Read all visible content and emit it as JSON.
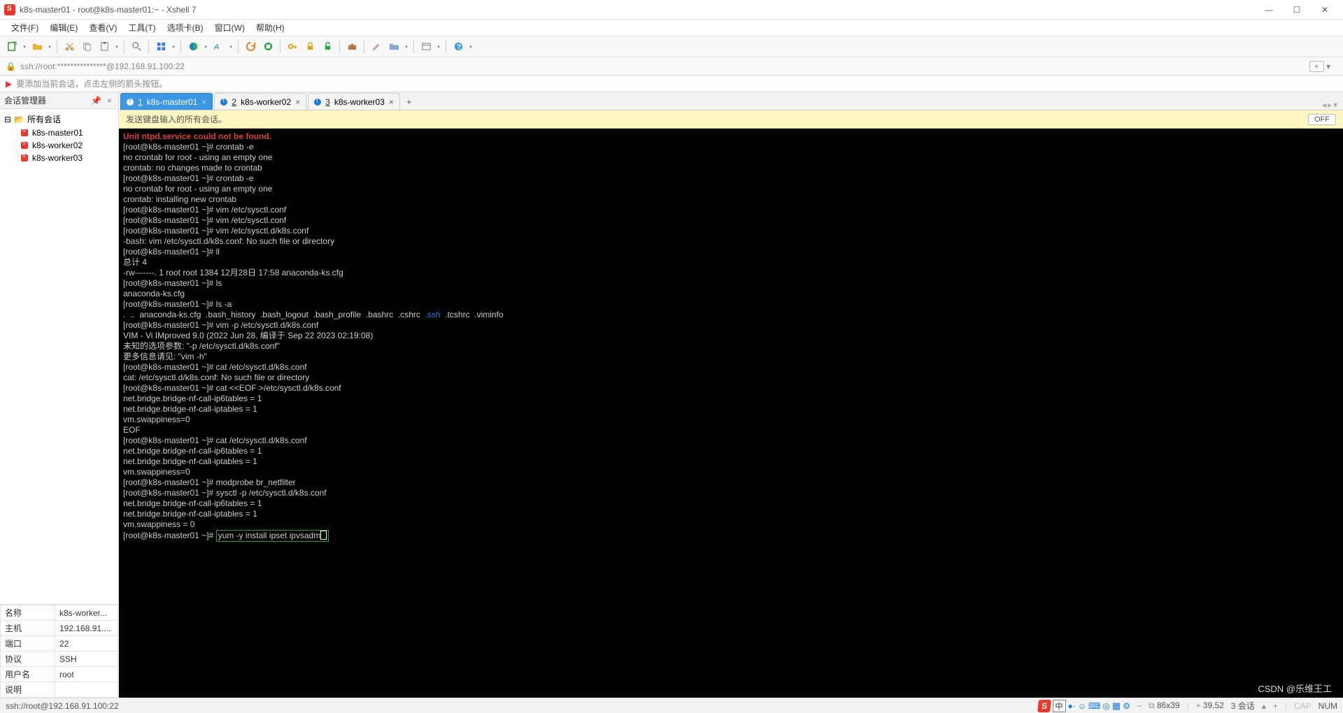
{
  "window": {
    "title": "k8s-master01 - root@k8s-master01:~ - Xshell 7",
    "minimize": "—",
    "maximize": "☐",
    "close": "✕"
  },
  "menu": {
    "file": "文件(F)",
    "edit": "编辑(E)",
    "view": "查看(V)",
    "tool": "工具(T)",
    "tabs": "选项卡(B)",
    "window": "窗口(W)",
    "help": "帮助(H)"
  },
  "url": {
    "text": "ssh://root:***************@192.168.91.100:22",
    "plus": "+"
  },
  "hint": {
    "text": "要添加当前会话，点击左侧的箭头按钮。"
  },
  "sidebar": {
    "title": "会话管理器",
    "pin": "📌",
    "close": "×",
    "root": "所有会话",
    "items": [
      "k8s-master01",
      "k8s-worker02",
      "k8s-worker03"
    ]
  },
  "props": {
    "rows": [
      {
        "k": "名称",
        "v": "k8s-worker..."
      },
      {
        "k": "主机",
        "v": "192.168.91...."
      },
      {
        "k": "端口",
        "v": "22"
      },
      {
        "k": "协议",
        "v": "SSH"
      },
      {
        "k": "用户名",
        "v": "root"
      },
      {
        "k": "说明",
        "v": ""
      }
    ]
  },
  "tabs": {
    "list": [
      {
        "num": "1",
        "label": "k8s-master01",
        "active": true
      },
      {
        "num": "2",
        "label": "k8s-worker02",
        "active": false
      },
      {
        "num": "3",
        "label": "k8s-worker03",
        "active": false
      }
    ],
    "add": "+"
  },
  "broadcast": {
    "text": "发送键盘输入的所有会话。",
    "off": "OFF"
  },
  "terminal": {
    "err": "Unit ntpd.service could not be found.",
    "l01": "[root@k8s-master01 ~]# crontab -e",
    "l02": "no crontab for root - using an empty one",
    "l03": "crontab: no changes made to crontab",
    "l04": "[root@k8s-master01 ~]# crontab -e",
    "l05": "no crontab for root - using an empty one",
    "l06": "crontab: installing new crontab",
    "l07": "[root@k8s-master01 ~]# vim /etc/sysctl.conf",
    "l08": "[root@k8s-master01 ~]# vim /etc/sysctl.conf",
    "l09": "[root@k8s-master01 ~]# vim /etc/sysctl.d/k8s.conf",
    "l10": "-bash: vim /etc/sysctl.d/k8s.conf: No such file or directory",
    "l11": "[root@k8s-master01 ~]# ll",
    "l12": "总计 4",
    "l13": "-rw-------. 1 root root 1384 12月28日 17:58 anaconda-ks.cfg",
    "l14": "[root@k8s-master01 ~]# ls",
    "l15": "anaconda-ks.cfg",
    "l16": "[root@k8s-master01 ~]# ls -a",
    "l17a": ".  ..  anaconda-ks.cfg  .bash_history  .bash_logout  .bash_profile  .bashrc  .cshrc  ",
    "l17b": ".ssh",
    "l17c": "  .tcshrc  .viminfo",
    "l18": "[root@k8s-master01 ~]# vim -p /etc/sysctl.d/k8s.conf",
    "l19": "VIM - Vi IMproved 9.0 (2022 Jun 28, 编译于 Sep 22 2023 02:19:08)",
    "l20": "未知的选项参数: \"-p /etc/sysctl.d/k8s.conf\"",
    "l21": "更多信息请见: \"vim -h\"",
    "l22": "[root@k8s-master01 ~]# cat /etc/sysctl.d/k8s.conf",
    "l23": "cat: /etc/sysctl.d/k8s.conf: No such file or directory",
    "l24": "[root@k8s-master01 ~]# cat <<EOF >/etc/sysctl.d/k8s.conf",
    "l25": "net.bridge.bridge-nf-call-ip6tables = 1",
    "l26": "net.bridge.bridge-nf-call-iptables = 1",
    "l27": "vm.swappiness=0",
    "l28": "EOF",
    "l29": "[root@k8s-master01 ~]# cat /etc/sysctl.d/k8s.conf",
    "l30": "net.bridge.bridge-nf-call-ip6tables = 1",
    "l31": "net.bridge.bridge-nf-call-iptables = 1",
    "l32": "vm.swappiness=0",
    "l33": "[root@k8s-master01 ~]# modprobe br_netfilter",
    "l34": "[root@k8s-master01 ~]# sysctl -p /etc/sysctl.d/k8s.conf",
    "l35": "net.bridge.bridge-nf-call-ip6tables = 1",
    "l36": "net.bridge.bridge-nf-call-iptables = 1",
    "l37": "vm.swappiness = 0",
    "l38p": "[root@k8s-master01 ~]# ",
    "l38c": "yum -y install ipset ipvsadm"
  },
  "status": {
    "left": "ssh://root@192.168.91.100:22",
    "size": "86x39",
    "pos": "39,52",
    "sess": "3 会话",
    "chars": "中",
    "num": "NUM",
    "sogou": "S",
    "ime_plus": "+"
  },
  "watermark": "CSDN @乐维王工"
}
